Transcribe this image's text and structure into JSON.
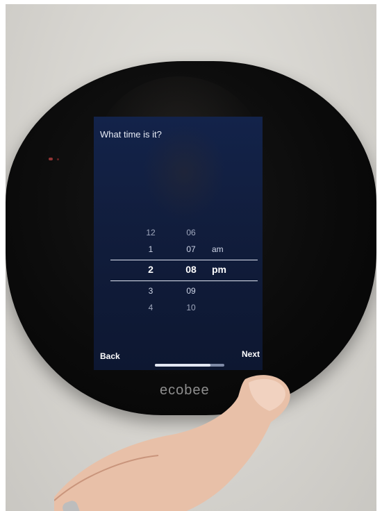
{
  "device": {
    "brand": "ecobee"
  },
  "screen": {
    "title": "What time is it?",
    "picker_rows": [
      {
        "hour": "12",
        "minute": "06",
        "period": ""
      },
      {
        "hour": "1",
        "minute": "07",
        "period": "am"
      },
      {
        "hour": "2",
        "minute": "08",
        "period": "pm"
      },
      {
        "hour": "3",
        "minute": "09",
        "period": ""
      },
      {
        "hour": "4",
        "minute": "10",
        "period": ""
      }
    ],
    "selected": {
      "hour": "2",
      "minute": "08",
      "period": "pm"
    },
    "back_label": "Back",
    "next_label": "Next",
    "progress_fraction": 0.8
  },
  "colors": {
    "screen_background": "#13234a",
    "screen_text": "#ffffff",
    "device_body": "#0a0a0a",
    "wall": "#d6d4cf"
  }
}
